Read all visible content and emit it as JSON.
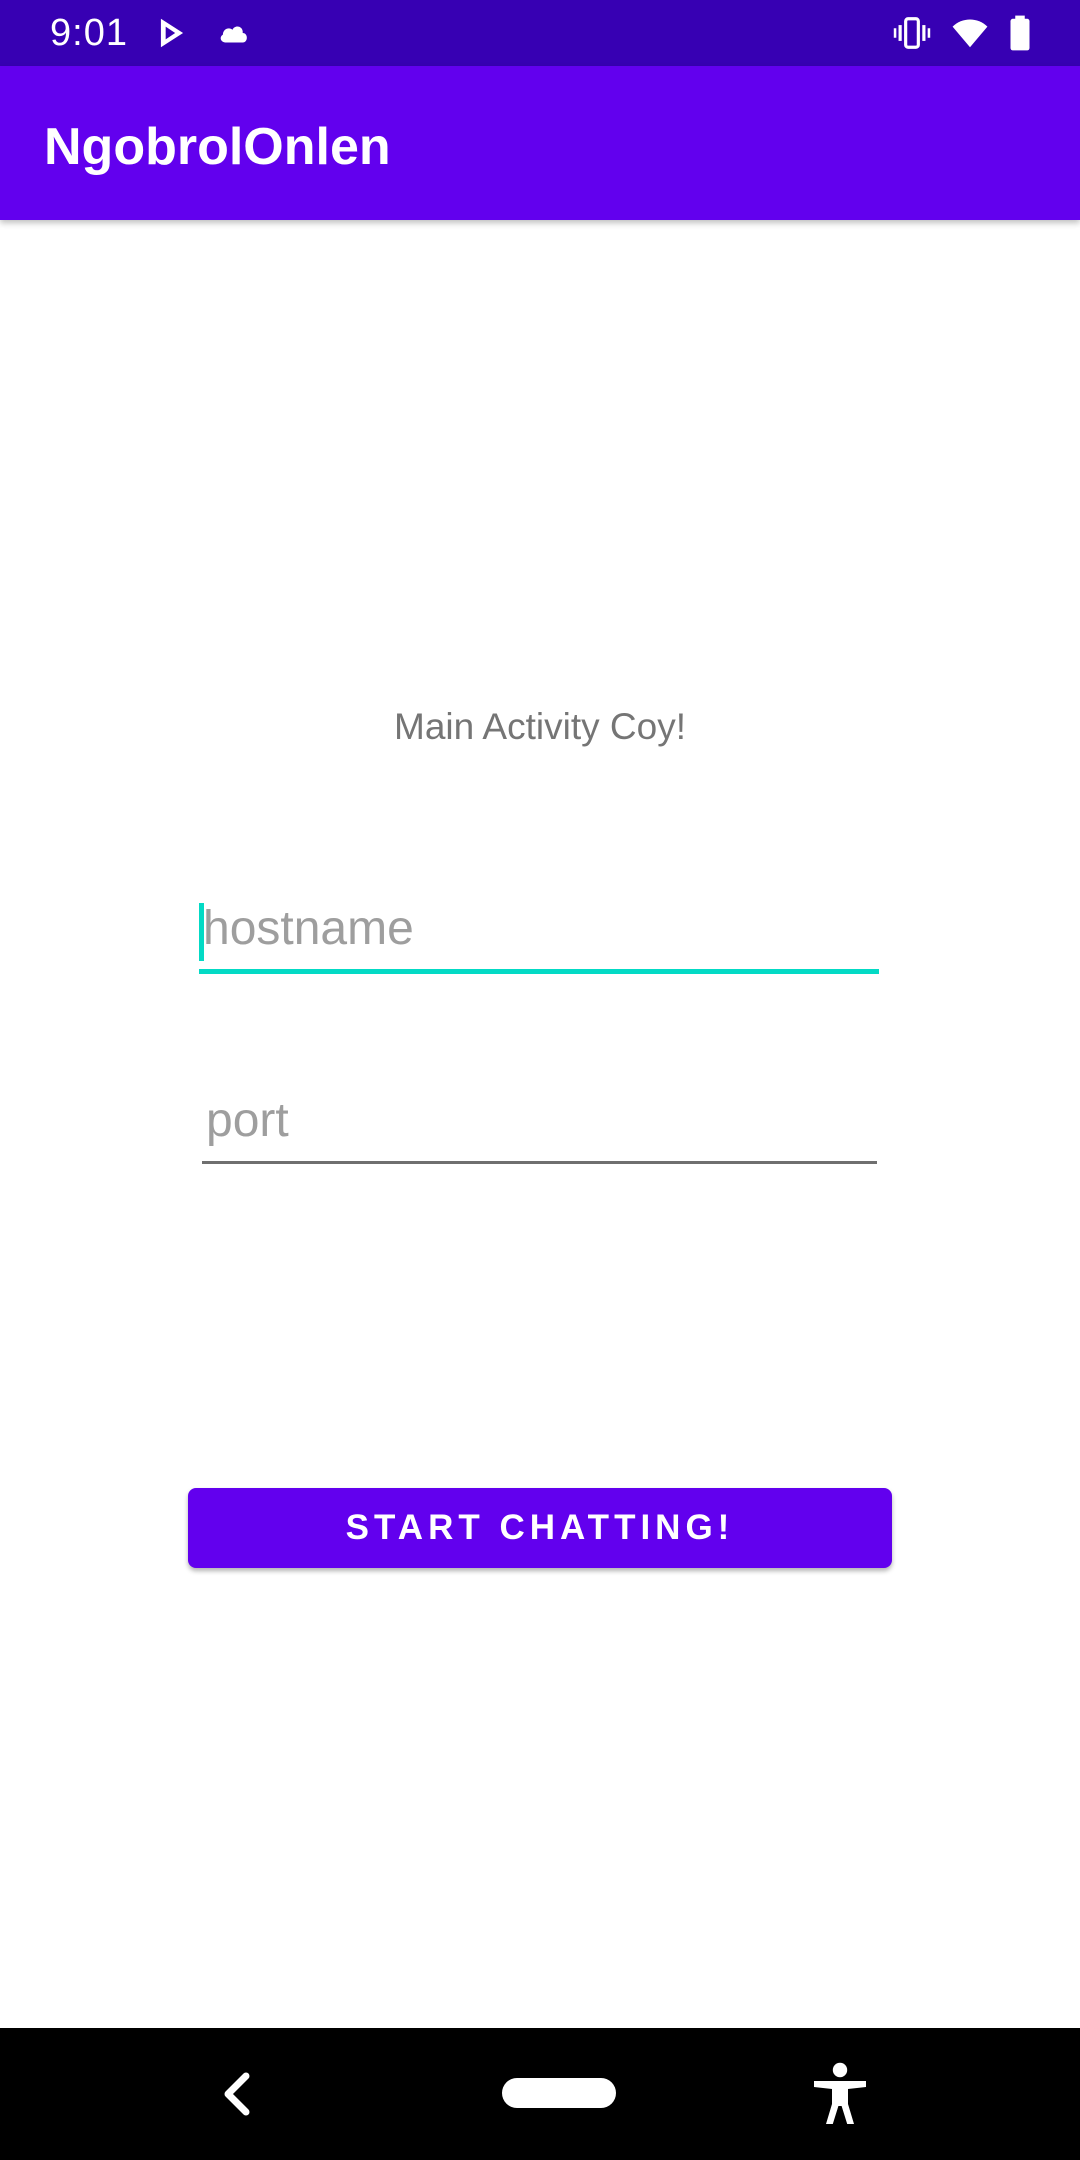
{
  "status_bar": {
    "time": "9:01",
    "icons": [
      "play-store-icon",
      "cloud-icon",
      "vibrate-icon",
      "wifi-icon",
      "battery-icon"
    ]
  },
  "app_bar": {
    "title": "NgobrolOnlen"
  },
  "main": {
    "label": "Main Activity Coy!",
    "hostname": {
      "value": "",
      "placeholder": "hostname",
      "focused": true
    },
    "port": {
      "value": "",
      "placeholder": "port"
    },
    "start_button_label": "START CHATTING!"
  },
  "nav_bar": {
    "icons": [
      "back-icon",
      "home-icon",
      "accessibility-icon"
    ]
  },
  "colors": {
    "status_bar": "#3700b3",
    "primary": "#6200ee",
    "accent": "#03dac5",
    "label_text": "#757575",
    "hint_text": "#9e9e9e"
  }
}
